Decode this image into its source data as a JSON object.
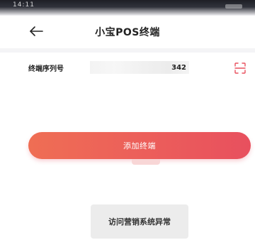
{
  "status_bar": {
    "left_text": "14:11"
  },
  "nav": {
    "title": "小宝POS终端",
    "back_icon": "arrow-left-icon"
  },
  "form": {
    "serial_label": "终端序列号",
    "serial_value": "342",
    "scan_icon": "scan-icon"
  },
  "actions": {
    "add_label": "添加终端"
  },
  "toast": {
    "message": "访问营销系统异常"
  },
  "colors": {
    "accent_start": "#ef6e54",
    "accent_end": "#e8505e",
    "scan_icon": "#e8505e",
    "toast_bg": "#ececec"
  }
}
